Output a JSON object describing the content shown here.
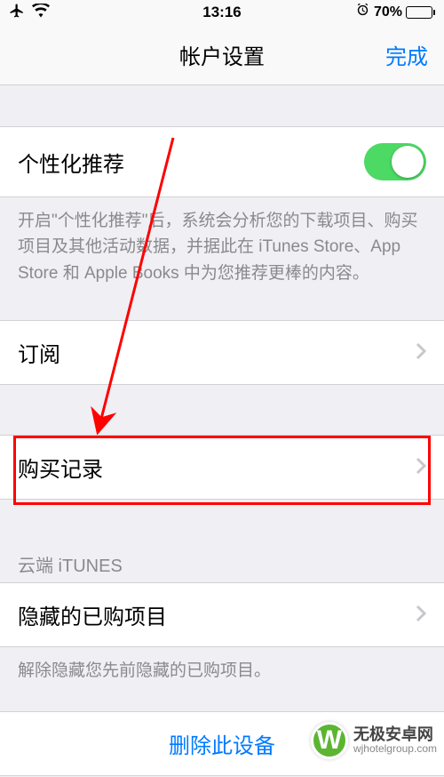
{
  "status": {
    "time": "13:16",
    "battery_percent": "70%"
  },
  "nav": {
    "title": "帐户设置",
    "done": "完成"
  },
  "personalized": {
    "label": "个性化推荐",
    "description": "开启\"个性化推荐\"后，系统会分析您的下载项目、购买项目及其他活动数据，并据此在 iTunes Store、App Store 和 Apple Books 中为您推荐更棒的内容。"
  },
  "subscription": {
    "label": "订阅"
  },
  "purchase_history": {
    "label": "购买记录"
  },
  "cloud_section": {
    "header": "云端 iTUNES",
    "hidden_label": "隐藏的已购项目",
    "hidden_desc": "解除隐藏您先前隐藏的已购项目。"
  },
  "delete": {
    "label": "删除此设备"
  },
  "watermark": {
    "cn": "无极安卓网",
    "url": "wjhotelgroup.com"
  }
}
